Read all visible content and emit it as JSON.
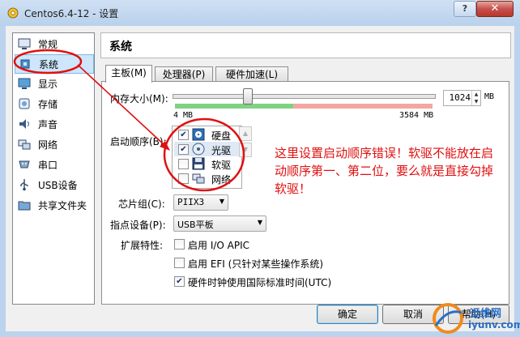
{
  "window": {
    "title": "Centos6.4-12 - 设置",
    "help": "?",
    "close": "✕"
  },
  "sidebar": {
    "items": [
      {
        "label": "常规",
        "icon": "monitor-icon"
      },
      {
        "label": "系统",
        "icon": "chip-icon"
      },
      {
        "label": "显示",
        "icon": "display-icon"
      },
      {
        "label": "存储",
        "icon": "storage-icon"
      },
      {
        "label": "声音",
        "icon": "speaker-icon"
      },
      {
        "label": "网络",
        "icon": "network-icon"
      },
      {
        "label": "串口",
        "icon": "serial-port-icon"
      },
      {
        "label": "USB设备",
        "icon": "usb-icon"
      },
      {
        "label": "共享文件夹",
        "icon": "shared-folder-icon"
      }
    ]
  },
  "section": {
    "title": "系统"
  },
  "tabs": [
    {
      "label": "主板(M)"
    },
    {
      "label": "处理器(P)"
    },
    {
      "label": "硬件加速(L)"
    }
  ],
  "motherboard": {
    "memory": {
      "label": "内存大小(M):",
      "value": "1024",
      "unit": "MB",
      "min_label": "4  MB",
      "max_label": "3584  MB",
      "fraction": 0.286
    },
    "boot_order": {
      "label": "启动顺序(B):",
      "items": [
        {
          "label": "硬盘",
          "checked": true,
          "icon": "hard-disk-icon"
        },
        {
          "label": "光驱",
          "checked": true,
          "icon": "optical-drive-icon"
        },
        {
          "label": "软驱",
          "checked": false,
          "icon": "floppy-icon"
        },
        {
          "label": "网络",
          "checked": false,
          "icon": "network-boot-icon"
        }
      ]
    },
    "chipset": {
      "label": "芯片组(C):",
      "value": "PIIX3"
    },
    "pointing": {
      "label": "指点设备(P):",
      "value": "USB平板"
    },
    "extended": {
      "label": "扩展特性:",
      "items": [
        {
          "label": "启用 I/O APIC",
          "checked": false
        },
        {
          "label": "启用 EFI (只针对某些操作系统)",
          "checked": false
        },
        {
          "label": "硬件时钟使用国际标准时间(UTC)",
          "checked": true
        }
      ]
    }
  },
  "buttons": {
    "ok": "确定",
    "cancel": "取消",
    "help": "帮助(H)"
  },
  "annotation": {
    "text": "这里设置启动顺序错误！软驱不能放在启动顺序第一、第二位，要么就是直接勾掉软驱！",
    "color": "#e01010"
  },
  "watermark": {
    "line1": "运维网",
    "line2": "iyunv.com"
  },
  "colors": {
    "accent": "#3c7fb1",
    "annotation": "#e01010",
    "scale_green": "#7fd27f",
    "scale_red": "#f4a6a0"
  }
}
